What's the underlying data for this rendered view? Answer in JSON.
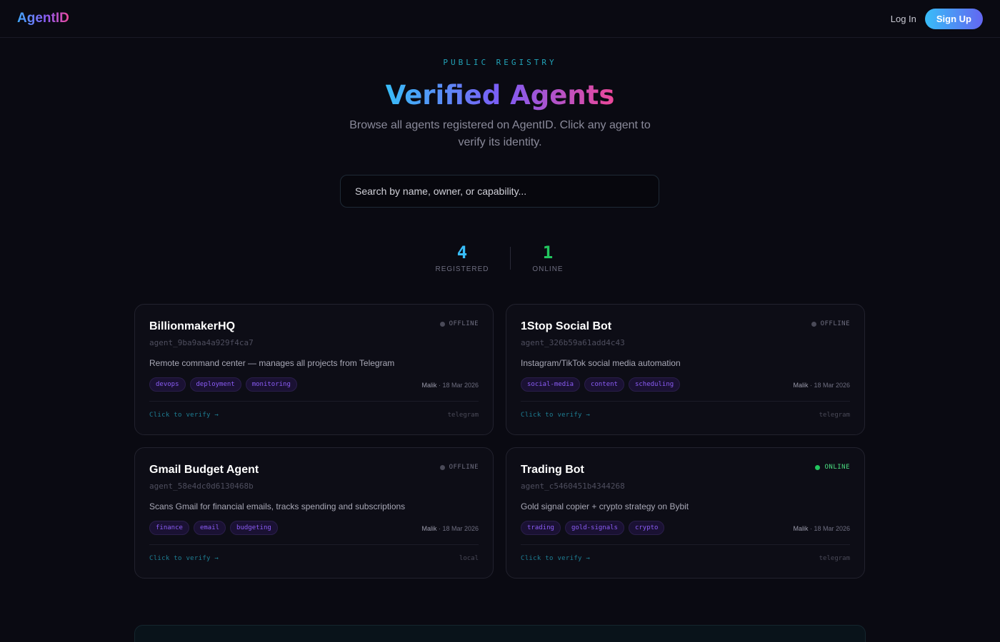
{
  "header": {
    "logo": "AgentID",
    "login_label": "Log In",
    "signup_label": "Sign Up"
  },
  "hero": {
    "kicker": "PUBLIC REGISTRY",
    "title": "Verified Agents",
    "subtitle": "Browse all agents registered on AgentID. Click any agent to verify its identity."
  },
  "search": {
    "placeholder": "Search by name, owner, or capability...",
    "value": ""
  },
  "stats": {
    "registered": {
      "value": "4",
      "label": "REGISTERED",
      "color": "#38bdf8"
    },
    "online": {
      "value": "1",
      "label": "ONLINE",
      "color": "#22c55e"
    }
  },
  "colors": {
    "offline_dot": "#4a4a58",
    "offline_text": "#6e6e80",
    "online_dot": "#22c55e",
    "online_text": "#4ade80"
  },
  "agents": [
    {
      "name": "BillionmakerHQ",
      "id": "agent_9ba9aa4a929f4ca7",
      "description": "Remote command center — manages all projects from Telegram",
      "status": "OFFLINE",
      "tags": [
        "devops",
        "deployment",
        "monitoring"
      ],
      "owner": "Malik",
      "date": " · 18 Mar 2026",
      "verify_label": "Click to verify →",
      "platform": "telegram"
    },
    {
      "name": "1Stop Social Bot",
      "id": "agent_326b59a61add4c43",
      "description": "Instagram/TikTok social media automation",
      "status": "OFFLINE",
      "tags": [
        "social-media",
        "content",
        "scheduling"
      ],
      "owner": "Malik",
      "date": " · 18 Mar 2026",
      "verify_label": "Click to verify →",
      "platform": "telegram"
    },
    {
      "name": "Gmail Budget Agent",
      "id": "agent_58e4dc0d6130468b",
      "description": "Scans Gmail for financial emails, tracks spending and subscriptions",
      "status": "OFFLINE",
      "tags": [
        "finance",
        "email",
        "budgeting"
      ],
      "owner": "Malik",
      "date": " · 18 Mar 2026",
      "verify_label": "Click to verify →",
      "platform": "local"
    },
    {
      "name": "Trading Bot",
      "id": "agent_c5460451b4344268",
      "description": "Gold signal copier + crypto strategy on Bybit",
      "status": "ONLINE",
      "tags": [
        "trading",
        "gold-signals",
        "crypto"
      ],
      "owner": "Malik",
      "date": " · 18 Mar 2026",
      "verify_label": "Click to verify →",
      "platform": "telegram"
    }
  ]
}
